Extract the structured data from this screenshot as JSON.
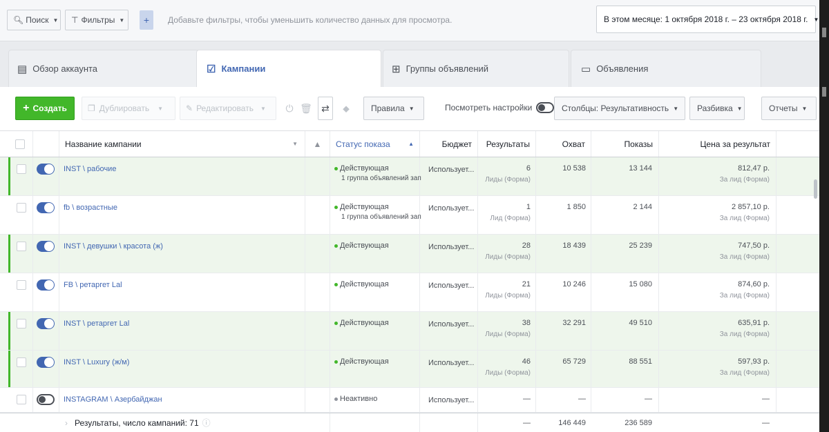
{
  "topbar": {
    "search_label": "Поиск",
    "filters_label": "Фильтры",
    "filter_hint": "Добавьте фильтры, чтобы уменьшить количество данных для просмотра.",
    "date_range": "В этом месяце: 1 октября 2018 г. – 23 октября 2018 г."
  },
  "tabs": {
    "overview": "Обзор аккаунта",
    "campaigns": "Кампании",
    "adsets": "Группы объявлений",
    "ads": "Объявления"
  },
  "toolbar": {
    "create": "Создать",
    "duplicate": "Дублировать",
    "edit": "Редактировать",
    "rules": "Правила",
    "view_settings": "Посмотреть настройки",
    "columns": "Столбцы: Результативность",
    "breakdown": "Разбивка",
    "reports": "Отчеты"
  },
  "table": {
    "headers": {
      "name": "Название кампании",
      "status": "Статус показа",
      "budget": "Бюджет",
      "results": "Результаты",
      "reach": "Охват",
      "impressions": "Показы",
      "cost": "Цена за результат"
    },
    "rows": [
      {
        "name": "INST \\ рабочие",
        "status": "Действующая",
        "status_sub": "1 группа объявлений зап",
        "budget": "Использует...",
        "results": "6",
        "results_sub": "Лиды (Форма)",
        "reach": "10 538",
        "impressions": "13 144",
        "cost": "812,47 р.",
        "cost_sub": "За лид (Форма)"
      },
      {
        "name": "fb \\ возрастные",
        "status": "Действующая",
        "status_sub": "1 группа объявлений зап",
        "budget": "Использует...",
        "results": "1",
        "results_sub": "Лид (Форма)",
        "reach": "1 850",
        "impressions": "2 144",
        "cost": "2 857,10 р.",
        "cost_sub": "За лид (Форма)"
      },
      {
        "name": "INST \\ девушки \\ красота (ж)",
        "status": "Действующая",
        "status_sub": "",
        "budget": "Использует...",
        "results": "28",
        "results_sub": "Лиды (Форма)",
        "reach": "18 439",
        "impressions": "25 239",
        "cost": "747,50 р.",
        "cost_sub": "За лид (Форма)"
      },
      {
        "name": "FB \\ ретаргет Lal",
        "status": "Действующая",
        "status_sub": "",
        "budget": "Использует...",
        "results": "21",
        "results_sub": "Лиды (Форма)",
        "reach": "10 246",
        "impressions": "15 080",
        "cost": "874,60 р.",
        "cost_sub": "За лид (Форма)"
      },
      {
        "name": "INST \\ ретаргет Lal",
        "status": "Действующая",
        "status_sub": "",
        "budget": "Использует...",
        "results": "38",
        "results_sub": "Лиды (Форма)",
        "reach": "32 291",
        "impressions": "49 510",
        "cost": "635,91 р.",
        "cost_sub": "За лид (Форма)"
      },
      {
        "name": "INST \\ Luxury (ж/м)",
        "status": "Действующая",
        "status_sub": "",
        "budget": "Использует...",
        "results": "46",
        "results_sub": "Лиды (Форма)",
        "reach": "65 729",
        "impressions": "88 551",
        "cost": "597,93 р.",
        "cost_sub": "За лид (Форма)"
      },
      {
        "name": "INSTAGRAM \\ Азербайджан",
        "status": "Неактивно",
        "status_sub": "",
        "budget": "Использует...",
        "results": "—",
        "results_sub": "",
        "reach": "—",
        "impressions": "—",
        "cost": "—",
        "cost_sub": ""
      }
    ],
    "footer": {
      "label": "Результаты, число кампаний: 71",
      "results": "—",
      "reach": "146 449",
      "impressions": "236 589",
      "cost": "—"
    }
  },
  "colors": {
    "accent": "#4267b2",
    "create": "#42b72a",
    "selected_row": "#eef6ec"
  }
}
